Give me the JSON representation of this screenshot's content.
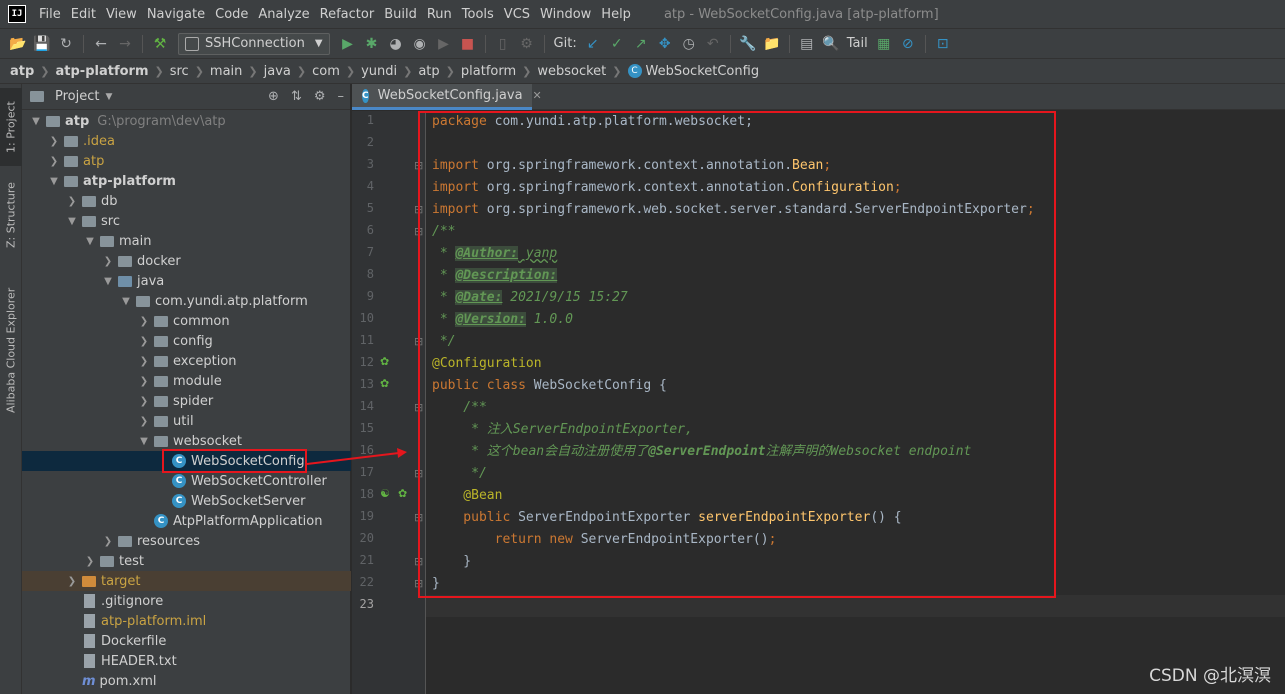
{
  "window": {
    "title": "atp - WebSocketConfig.java [atp-platform]"
  },
  "menu": [
    "File",
    "Edit",
    "View",
    "Navigate",
    "Code",
    "Analyze",
    "Refactor",
    "Build",
    "Run",
    "Tools",
    "VCS",
    "Window",
    "Help"
  ],
  "toolbar": {
    "run_config": "SSHConnection",
    "git_label": "Git:",
    "tail_label": "Tail"
  },
  "breadcrumb": [
    "atp",
    "atp-platform",
    "src",
    "main",
    "java",
    "com",
    "yundi",
    "atp",
    "platform",
    "websocket",
    "WebSocketConfig"
  ],
  "side_tabs": {
    "project": "1: Project",
    "structure": "Z: Structure",
    "cloud": "Alibaba Cloud Explorer"
  },
  "project_panel": {
    "title": "Project",
    "tree": [
      {
        "label": "atp",
        "extra": "G:\\program\\dev\\atp",
        "icon": "folder",
        "expanded": true
      },
      {
        "label": ".idea",
        "icon": "folder",
        "expanded": false
      },
      {
        "label": "atp",
        "icon": "folder",
        "expanded": false
      },
      {
        "label": "atp-platform",
        "icon": "folder",
        "expanded": true
      },
      {
        "label": "db",
        "icon": "folder",
        "expanded": false
      },
      {
        "label": "src",
        "icon": "folder",
        "expanded": true
      },
      {
        "label": "main",
        "icon": "folder",
        "expanded": true
      },
      {
        "label": "docker",
        "icon": "folder",
        "expanded": false
      },
      {
        "label": "java",
        "icon": "folder-blue",
        "expanded": true
      },
      {
        "label": "com.yundi.atp.platform",
        "icon": "folder",
        "expanded": true
      },
      {
        "label": "common",
        "icon": "folder",
        "expanded": false
      },
      {
        "label": "config",
        "icon": "folder",
        "expanded": false
      },
      {
        "label": "exception",
        "icon": "folder",
        "expanded": false
      },
      {
        "label": "module",
        "icon": "folder",
        "expanded": false
      },
      {
        "label": "spider",
        "icon": "folder",
        "expanded": false
      },
      {
        "label": "util",
        "icon": "folder",
        "expanded": false
      },
      {
        "label": "websocket",
        "icon": "folder",
        "expanded": true
      },
      {
        "label": "WebSocketConfig",
        "icon": "java-class"
      },
      {
        "label": "WebSocketController",
        "icon": "java-class"
      },
      {
        "label": "WebSocketServer",
        "icon": "java-class"
      },
      {
        "label": "AtpPlatformApplication",
        "icon": "java-class"
      },
      {
        "label": "resources",
        "icon": "folder",
        "expanded": false
      },
      {
        "label": "test",
        "icon": "folder",
        "expanded": false
      },
      {
        "label": "target",
        "icon": "folder-orange",
        "expanded": false
      },
      {
        "label": ".gitignore",
        "icon": "file"
      },
      {
        "label": "atp-platform.iml",
        "icon": "file"
      },
      {
        "label": "Dockerfile",
        "icon": "file"
      },
      {
        "label": "HEADER.txt",
        "icon": "file"
      },
      {
        "label": "pom.xml",
        "icon": "maven"
      }
    ]
  },
  "editor": {
    "tab_label": "WebSocketConfig.java",
    "line_numbers": [
      "1",
      "2",
      "3",
      "4",
      "5",
      "6",
      "7",
      "8",
      "9",
      "10",
      "11",
      "12",
      "13",
      "14",
      "15",
      "16",
      "17",
      "18",
      "19",
      "20",
      "21",
      "22",
      "23"
    ],
    "code": {
      "l1_kw": "package",
      "l1_rest": " com.yundi.atp.platform.websocket;",
      "l3_kw": "import",
      "l3_path": " org.springframework.context.annotation.",
      "l3_cls": "Bean",
      "l4_kw": "import",
      "l4_path": " org.springframework.context.annotation.",
      "l4_cls": "Configuration",
      "l5_kw": "import",
      "l5_path": " org.springframework.web.socket.server.standard.ServerEndpointExporter",
      "l6": "/**",
      "l7_star": " * ",
      "l7_tag": "@Author:",
      "l7_val": " yanp",
      "l8_star": " * ",
      "l8_tag": "@Description:",
      "l9_star": " * ",
      "l9_tag": "@Date:",
      "l9_val": " 2021/9/15 15:27",
      "l10_star": " * ",
      "l10_tag": "@Version:",
      "l10_val": " 1.0.0",
      "l11": " */",
      "l12": "@Configuration",
      "l13_kw": "public class",
      "l13_name": " WebSocketConfig {",
      "l14": "    /**",
      "l15": "     * 注入ServerEndpointExporter,",
      "l16_pre": "     * 这个bean会自动注册使用了",
      "l16_ann": "@ServerEndpoint",
      "l16_post": "注解声明的Websocket endpoint",
      "l17": "     */",
      "l18": "    @Bean",
      "l19_kw": "    public",
      "l19_type": " ServerEndpointExporter ",
      "l19_fn": "serverEndpointExporter",
      "l19_rest": "() {",
      "l20_kw1": "        return",
      "l20_kw2": " new",
      "l20_rest": " ServerEndpointExporter()",
      "l21": "    }",
      "l22": "}"
    }
  },
  "watermark": "CSDN @北溟溟",
  "colors": {
    "keyword": "#cc7832",
    "comment": "#629755",
    "annotation": "#bbb529",
    "method": "#ffc66d",
    "highlight_box": "#e5161d"
  }
}
